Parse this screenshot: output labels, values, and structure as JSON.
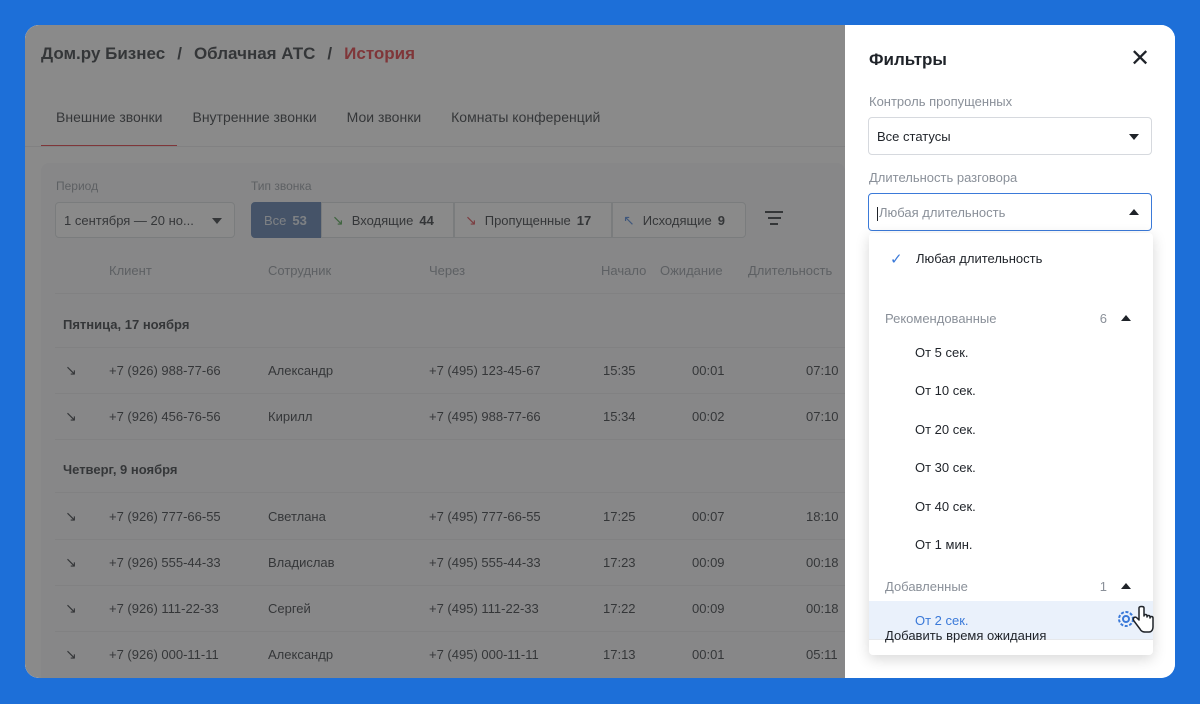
{
  "breadcrumb": {
    "item1": "Дом.ру Бизнес",
    "item2": "Облачная АТС",
    "item3": "История",
    "sep": "/"
  },
  "tabs": [
    "Внешние звонки",
    "Внутренние звонки",
    "Мои звонки",
    "Комнаты конференций"
  ],
  "filters": {
    "period_label": "Период",
    "period_value": "1 сентября — 20 но...",
    "type_label": "Тип звонка",
    "all_label": "Все",
    "all_count": "53",
    "in_label": "Входящие",
    "in_count": "44",
    "miss_label": "Пропущенные",
    "miss_count": "17",
    "out_label": "Исходящие",
    "out_count": "9"
  },
  "table": {
    "headers": [
      "Клиент",
      "Сотрудник",
      "Через",
      "Начало",
      "Ожидание",
      "Длительность"
    ],
    "day1": "Пятница, 17 ноября",
    "day2": "Четверг, 9 ноября",
    "rows": [
      {
        "client": "+7 (926) 988-77-66",
        "employee": "Александр",
        "via": "+7 (495) 123-45-67",
        "start": "15:35",
        "wait": "00:01",
        "dur": "07:10",
        "type": "in"
      },
      {
        "client": "+7 (926) 456-76-56",
        "employee": "Кирилл",
        "via": "+7 (495) 988-77-66",
        "start": "15:34",
        "wait": "00:02",
        "dur": "07:10",
        "type": "miss"
      },
      {
        "client": "+7 (926) 777-66-55",
        "employee": "Светлана",
        "via": "+7 (495) 777-66-55",
        "start": "17:25",
        "wait": "00:07",
        "dur": "18:10",
        "type": "in"
      },
      {
        "client": "+7 (926) 555-44-33",
        "employee": "Владислав",
        "via": "+7 (495) 555-44-33",
        "start": "17:23",
        "wait": "00:09",
        "dur": "00:18",
        "type": "in"
      },
      {
        "client": "+7 (926) 111-22-33",
        "employee": "Сергей",
        "via": "+7 (495) 111-22-33",
        "start": "17:22",
        "wait": "00:09",
        "dur": "00:18",
        "type": "miss"
      },
      {
        "client": "+7 (926) 000-11-11",
        "employee": "Александр",
        "via": "+7 (495) 000-11-11",
        "start": "17:13",
        "wait": "00:01",
        "dur": "05:11",
        "type": "in"
      }
    ]
  },
  "drawer": {
    "title": "Фильтры",
    "missed_label": "Контроль пропущенных",
    "missed_value": "Все статусы",
    "duration_label": "Длительность разговора",
    "duration_placeholder": "Любая длительность",
    "dropdown": {
      "any": "Любая длительность",
      "recommended": "Рекомендованные",
      "recommended_count": "6",
      "options": [
        "От 5 сек.",
        "От 10 сек.",
        "От 20 сек.",
        "От 30 сек.",
        "От 40 сек.",
        "От 1 мин."
      ],
      "added": "Добавленные",
      "added_count": "1",
      "added_option": "От 2 сек.",
      "add_wait": "Добавить время ожидания"
    }
  },
  "colors": {
    "accent": "#e3242b",
    "blue": "#3b7ad9",
    "segment_active": "#4a6fa5"
  }
}
